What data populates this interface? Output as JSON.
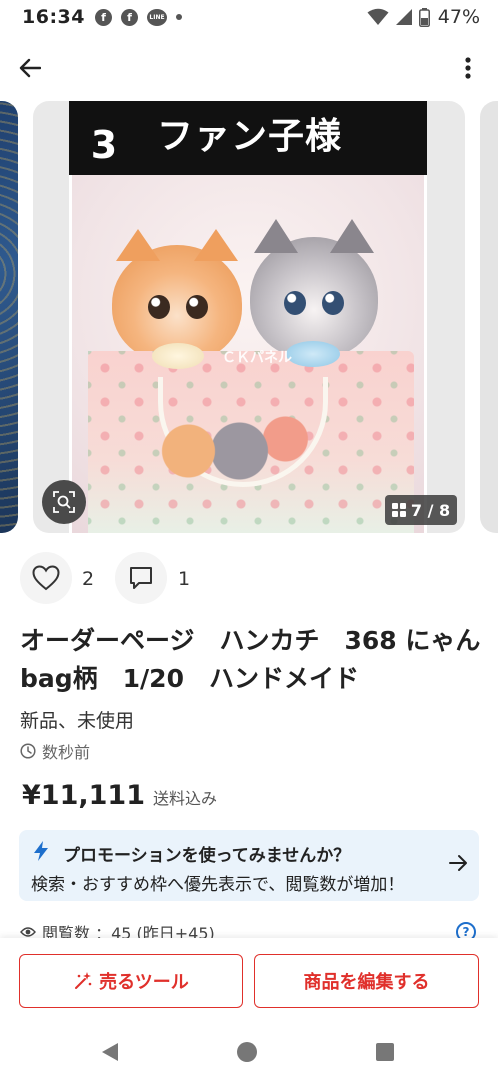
{
  "status_bar": {
    "time": "16:34",
    "notification_icons": [
      "facebook-icon",
      "facebook-icon",
      "line-icon",
      "dot-icon"
    ],
    "line_label": "LINE",
    "battery": "47%"
  },
  "app_bar": {
    "back_icon": "arrow-left-icon",
    "more_icon": "more-vertical-icon"
  },
  "gallery": {
    "banner_number": "3",
    "banner_text": "ファン子様",
    "watermark": "ＣＫパネル",
    "counter": "7 / 8",
    "zoom_icon": "zoom-scan-icon"
  },
  "reactions": {
    "like_count": "2",
    "comment_count": "1"
  },
  "item": {
    "title": "オーダーページ　ハンカチ　368 にゃんbag柄　1/20　ハンドメイド",
    "condition": "新品、未使用",
    "listed_time": "数秒前",
    "price": "¥11,111",
    "shipping": "送料込み"
  },
  "promotion": {
    "title": "プロモーションを使ってみませんか？",
    "description": "検索・おすすめ枠へ優先表示で、閲覧数が増加！"
  },
  "views": {
    "label": "閲覧数 ：45 (昨日+45)"
  },
  "actions": {
    "sell_tools": "売るツール",
    "edit_item": "商品を編集する"
  },
  "colors": {
    "accent": "#e0302b",
    "promo_bg": "#eaf3fb",
    "link": "#1e6fcc"
  }
}
